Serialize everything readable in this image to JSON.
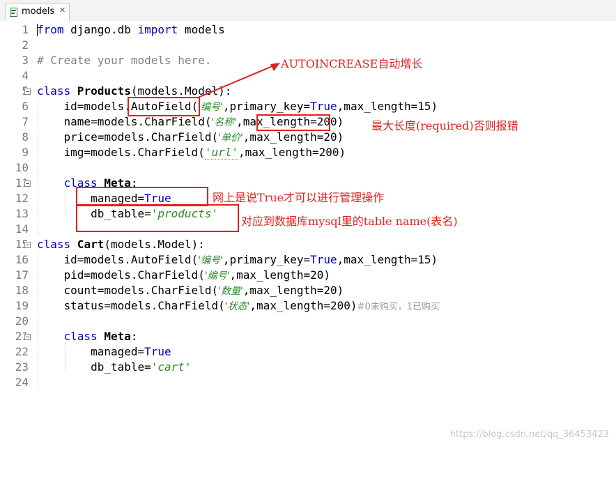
{
  "tab": {
    "label": "models",
    "close_glyph": "✕"
  },
  "line_numbers": [
    "1",
    "2",
    "3",
    "4",
    "5",
    "6",
    "7",
    "8",
    "9",
    "10",
    "11",
    "12",
    "13",
    "14",
    "15",
    "16",
    "17",
    "18",
    "19",
    "20",
    "21",
    "22",
    "23",
    "24"
  ],
  "code": {
    "l1_from": "from",
    "l1_mod": " django.db ",
    "l1_import": "import",
    "l1_rest": " models",
    "l3_comment": "# Create your models here.",
    "l5_class": "class",
    "l5_name": " Products",
    "l5_rest": "(models.Model):",
    "l6_a": "    id=models.",
    "l6_b": "AutoField",
    "l6_c": "(",
    "l6_str": "'编号'",
    "l6_d": ",primary_key=",
    "l6_true": "True",
    "l6_e": ",max_length=15)",
    "l7_a": "    name=models.CharField(",
    "l7_str": "'名称'",
    "l7_b": ",",
    "l7_c": "max_length",
    "l7_d": "=200)",
    "l8_a": "    price=models.CharField(",
    "l8_str": "'单价'",
    "l8_b": ",max_length=20)",
    "l9_a": "    img=models.CharField(",
    "l9_str": "'url'",
    "l9_b": ",max_length=200)",
    "l11_class": "    class",
    "l11_meta": " Meta",
    "l11_colon": ":",
    "l12_a": "        managed=",
    "l12_true": "True",
    "l13_a": "        db_table=",
    "l13_str": "'products'",
    "l15_class": "class",
    "l15_name": " Cart",
    "l15_rest": "(models.Model):",
    "l16_a": "    id=models.AutoField(",
    "l16_str": "'编号'",
    "l16_b": ",primary_key=",
    "l16_true": "True",
    "l16_c": ",max_length=15)",
    "l17_a": "    pid=models.CharField(",
    "l17_str": "'编号'",
    "l17_b": ",max_length=20)",
    "l18_a": "    count=models.CharField(",
    "l18_str": "'数量'",
    "l18_b": ",max_length=20)",
    "l19_a": "    status=models.CharField(",
    "l19_str": "'状态'",
    "l19_b": ",max_length=200)",
    "l19_cmt": "#0未购买，1已购买",
    "l21_class": "    class",
    "l21_meta": " Meta",
    "l21_colon": ":",
    "l22_a": "        managed=",
    "l22_true": "True",
    "l23_a": "        db_table=",
    "l23_str": "'cart'"
  },
  "annotations": {
    "autoincrease": "AUTOINCREASE自动增长",
    "max_length_note": "最大长度(required)否则报错",
    "managed_note": "网上是说True才可以进行管理操作",
    "db_table_note": "对应到数据库mysql里的table name(表名)"
  },
  "watermark": "https://blog.csdn.net/qq_36453423",
  "colors": {
    "annotation": "#e02020",
    "keyword": "#0000c0",
    "string": "#2a8a2a"
  }
}
